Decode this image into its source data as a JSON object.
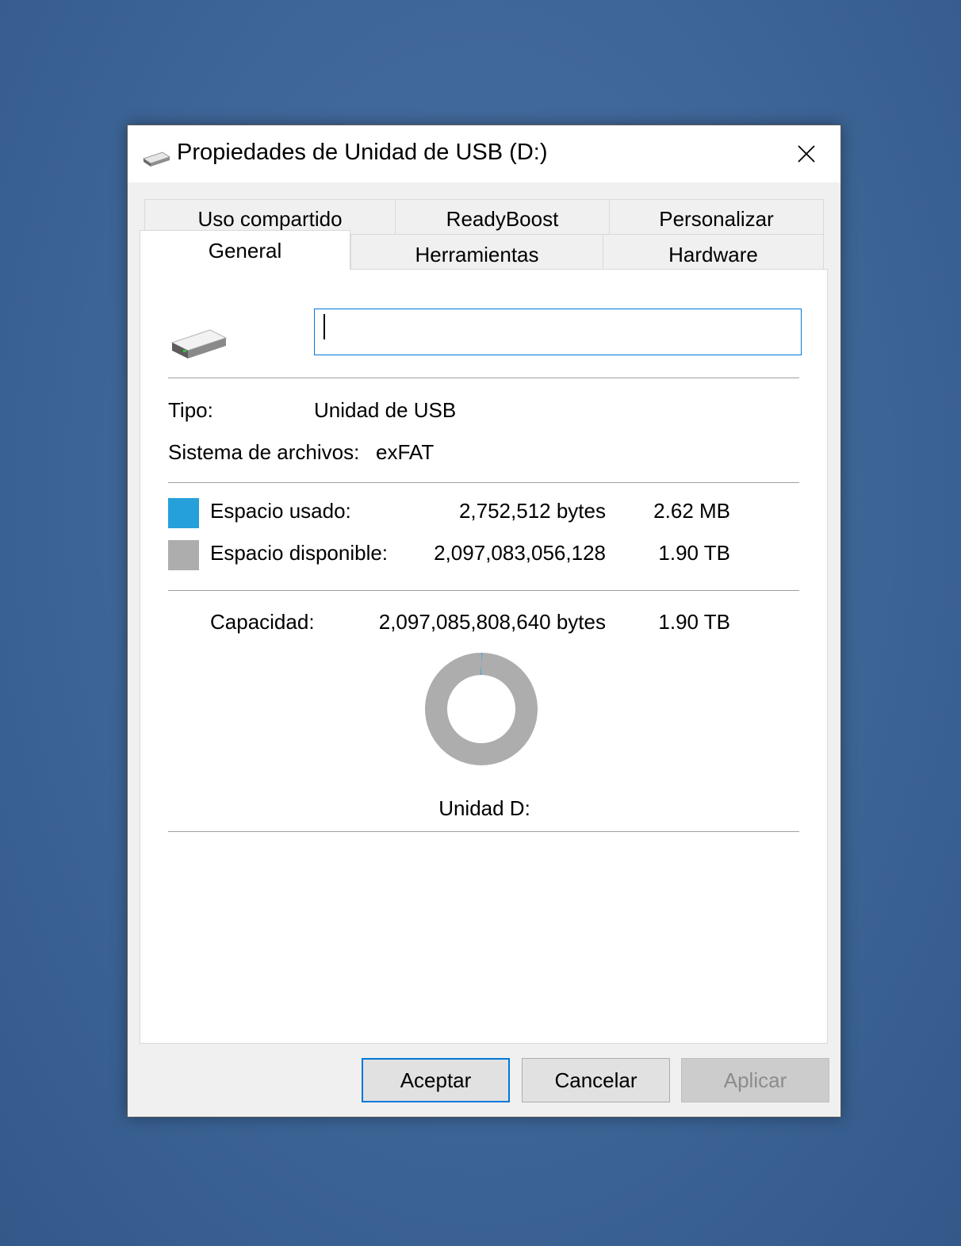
{
  "window": {
    "title": "Propiedades de Unidad de USB (D:)",
    "title_icon": "usb-drive-icon",
    "close_icon": "close-icon"
  },
  "tabs": {
    "row_top": [
      "Uso compartido",
      "ReadyBoost",
      "Personalizar"
    ],
    "row_bottom": [
      "General",
      "Herramientas",
      "Hardware"
    ],
    "active": "General"
  },
  "general": {
    "drive_icon": "drive-icon",
    "name_value": "",
    "type_label": "Tipo:",
    "type_value": "Unidad de USB",
    "fs_label": "Sistema de archivos:",
    "fs_value": "exFAT",
    "used": {
      "label": "Espacio usado:",
      "bytes": "2,752,512 bytes",
      "size": "2.62 MB",
      "color": "#26a0da"
    },
    "free": {
      "label": "Espacio disponible:",
      "bytes": "2,097,083,056,128",
      "size": "1.90 TB",
      "color": "#adadad"
    },
    "capacity": {
      "label": "Capacidad:",
      "bytes": "2,097,085,808,640 bytes",
      "size": "1.90 TB"
    },
    "usage_fraction": 1.3e-06,
    "drive_label": "Unidad D:"
  },
  "buttons": {
    "ok": "Aceptar",
    "cancel": "Cancelar",
    "apply": "Aplicar"
  }
}
